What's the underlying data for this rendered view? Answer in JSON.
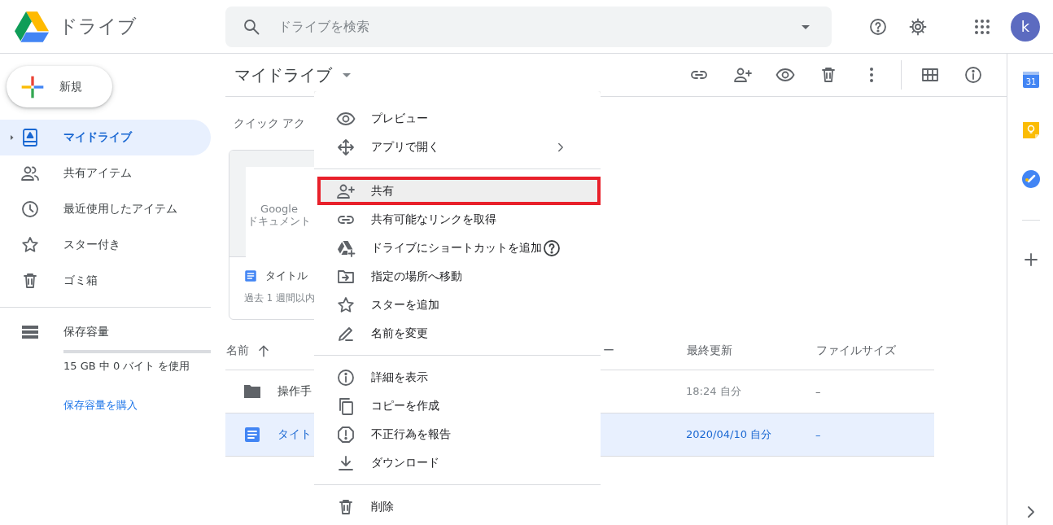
{
  "header": {
    "app_name": "ドライブ",
    "search": {
      "placeholder": "ドライブを検索"
    },
    "avatar": "k"
  },
  "sidebar": {
    "new_button": "新規",
    "items": [
      {
        "label": "マイドライブ",
        "selected": true,
        "expandable": true
      },
      {
        "label": "共有アイテム",
        "selected": false,
        "expandable": false
      },
      {
        "label": "最近使用したアイテム",
        "selected": false,
        "expandable": false
      },
      {
        "label": "スター付き",
        "selected": false,
        "expandable": false
      },
      {
        "label": "ゴミ箱",
        "selected": false,
        "expandable": false
      }
    ],
    "storage": {
      "label": "保存容量",
      "level": 0,
      "usage": "15 GB 中 0 バイト を使用",
      "buy_link": "保存容量を購入"
    }
  },
  "main": {
    "title": "マイドライブ",
    "quick_access": {
      "heading": "クイック アク",
      "card": {
        "thumbnail_text": "Google ドキュメント",
        "title": "タイトル",
        "subtitle": "過去 1 週間以内"
      }
    },
    "table": {
      "columns": [
        {
          "label": "名前",
          "sorted": true
        },
        {
          "label": "ー",
          "sorted": false
        },
        {
          "label": "最終更新",
          "sorted": false
        },
        {
          "label": "ファイルサイズ",
          "sorted": false
        }
      ],
      "rows": [
        {
          "kind": "folder",
          "name": "操作手",
          "modified": "18:24 自分",
          "size": "–",
          "selected": false
        },
        {
          "kind": "document",
          "name": "タイト",
          "modified": "2020/04/10 自分",
          "size": "–",
          "selected": true
        }
      ]
    }
  },
  "context_menu": {
    "groups": [
      [
        {
          "label": "プレビュー",
          "selected": false,
          "outlined": false,
          "submenu": false,
          "help": false
        },
        {
          "label": "アプリで開く",
          "selected": false,
          "outlined": false,
          "submenu": true,
          "help": false
        }
      ],
      [
        {
          "label": "共有",
          "selected": true,
          "outlined": true,
          "submenu": false,
          "help": false
        },
        {
          "label": "共有可能なリンクを取得",
          "selected": false,
          "outlined": false,
          "submenu": false,
          "help": false
        },
        {
          "label": "ドライブにショートカットを追加",
          "selected": false,
          "outlined": false,
          "submenu": false,
          "help": true
        },
        {
          "label": "指定の場所へ移動",
          "selected": false,
          "outlined": false,
          "submenu": false,
          "help": false
        },
        {
          "label": "スターを追加",
          "selected": false,
          "outlined": false,
          "submenu": false,
          "help": false
        },
        {
          "label": "名前を変更",
          "selected": false,
          "outlined": false,
          "submenu": false,
          "help": false
        }
      ],
      [
        {
          "label": "詳細を表示",
          "selected": false,
          "outlined": false,
          "submenu": false,
          "help": false
        },
        {
          "label": "コピーを作成",
          "selected": false,
          "outlined": false,
          "submenu": false,
          "help": false
        },
        {
          "label": "不正行為を報告",
          "selected": false,
          "outlined": false,
          "submenu": false,
          "help": false
        },
        {
          "label": "ダウンロード",
          "selected": false,
          "outlined": false,
          "submenu": false,
          "help": false
        }
      ],
      [
        {
          "label": "削除",
          "selected": false,
          "outlined": false,
          "submenu": false,
          "help": false
        }
      ]
    ]
  },
  "side_panel": {
    "calendar_day": "31"
  }
}
